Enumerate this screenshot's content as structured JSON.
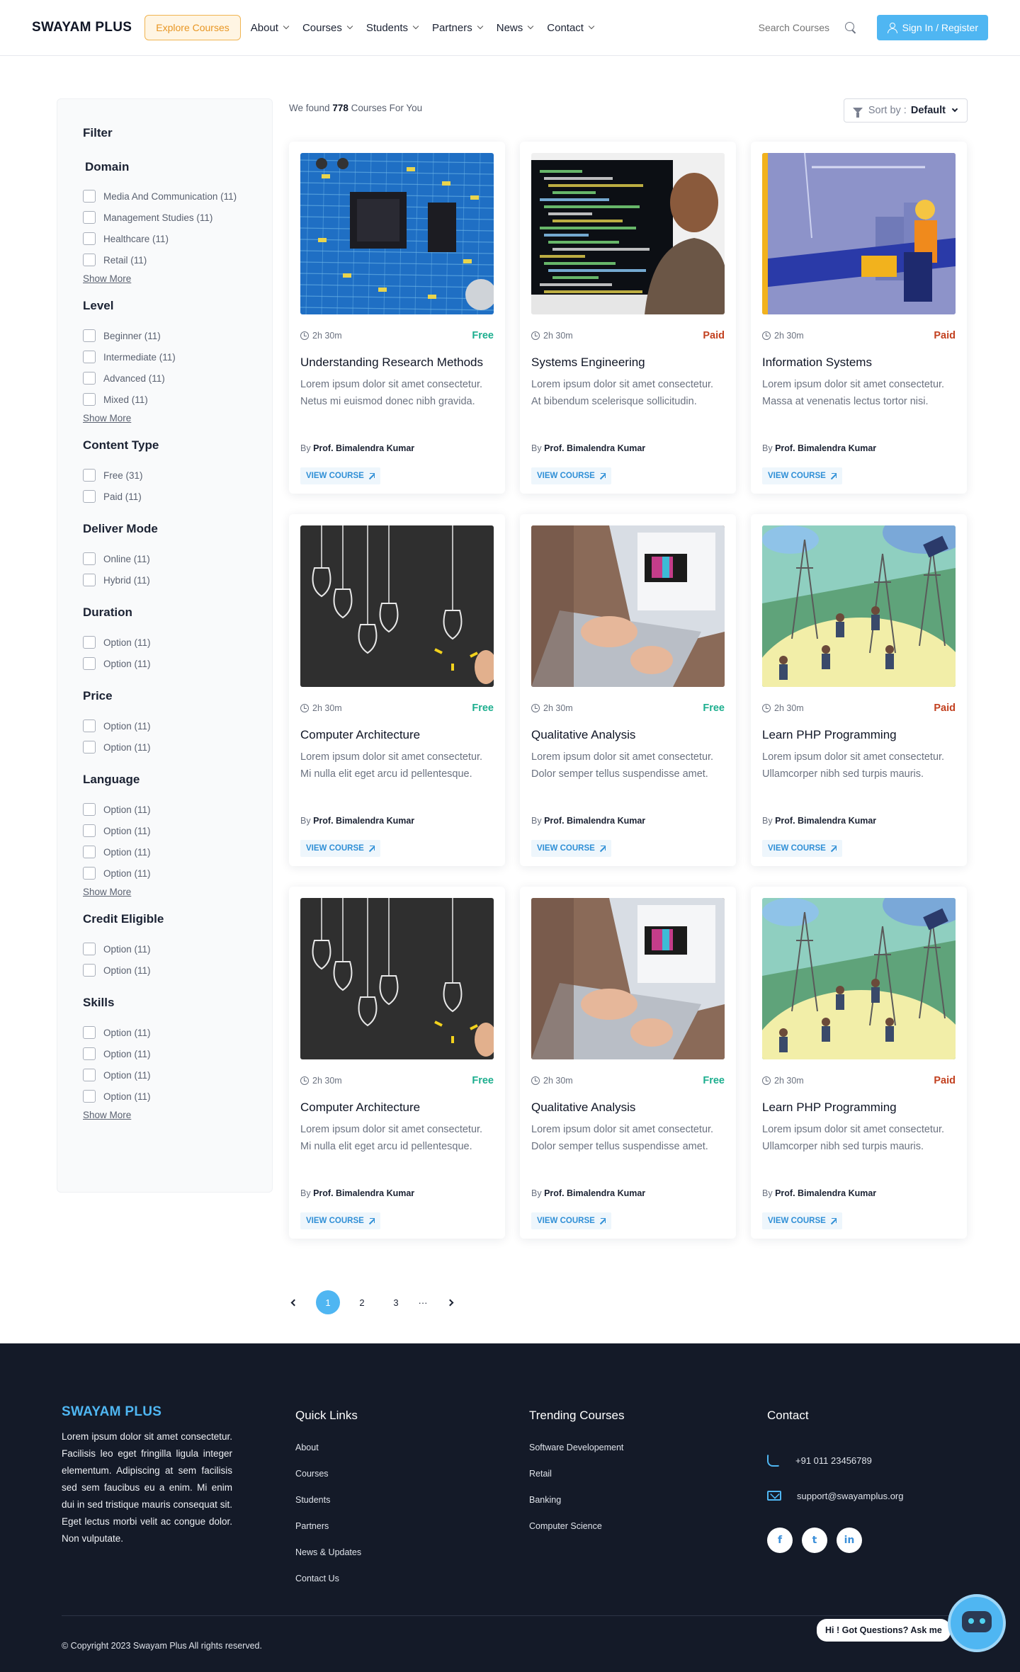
{
  "header": {
    "logo": "SWAYAM PLUS",
    "explore_label": "Explore Courses",
    "nav": [
      "About",
      "Courses",
      "Students",
      "Partners",
      "News",
      "Contact"
    ],
    "search_placeholder": "Search Courses",
    "signin_label": "Sign In / Register"
  },
  "filters": {
    "title": "Filter",
    "show_more": "Show More",
    "groups": [
      {
        "title": "Domain",
        "options": [
          "Media And Communication (11)",
          "Management Studies (11)",
          "Healthcare (11)",
          "Retail (11)"
        ],
        "show_more": true
      },
      {
        "title": "Level",
        "options": [
          "Beginner (11)",
          "Intermediate (11)",
          "Advanced (11)",
          "Mixed (11)"
        ],
        "show_more": true
      },
      {
        "title": "Content Type",
        "options": [
          "Free (31)",
          "Paid (11)"
        ],
        "show_more": false
      },
      {
        "title": "Deliver Mode",
        "options": [
          "Online (11)",
          "Hybrid (11)"
        ],
        "show_more": false
      },
      {
        "title": "Duration",
        "options": [
          "Option (11)",
          "Option (11)"
        ],
        "show_more": false
      },
      {
        "title": "Price",
        "options": [
          "Option (11)",
          "Option (11)"
        ],
        "show_more": false
      },
      {
        "title": "Language",
        "options": [
          "Option (11)",
          "Option (11)",
          "Option (11)",
          "Option (11)"
        ],
        "show_more": true
      },
      {
        "title": "Credit Eligible",
        "options": [
          "Option (11)",
          "Option (11)"
        ],
        "show_more": false
      },
      {
        "title": "Skills",
        "options": [
          "Option (11)",
          "Option (11)",
          "Option (11)",
          "Option (11)"
        ],
        "show_more": true
      }
    ]
  },
  "results": {
    "found_prefix": "We found",
    "found_count": "778",
    "found_suffix": "Courses For You",
    "sort_label": "Sort by :",
    "sort_value": "Default"
  },
  "courses": [
    {
      "image": "circuit",
      "duration": "2h 30m",
      "price": "Free",
      "title": "Understanding Research Methods",
      "desc": "Lorem ipsum dolor sit amet consectetur. Netus mi euismod donec nibh gravida.",
      "by": "By",
      "author": "Prof. Bimalendra Kumar",
      "cta": "VIEW COURSE"
    },
    {
      "image": "code",
      "duration": "2h 30m",
      "price": "Paid",
      "title": "Systems Engineering",
      "desc": "Lorem ipsum dolor sit amet consectetur. At bibendum scelerisque sollicitudin.",
      "by": "By",
      "author": "Prof. Bimalendra Kumar",
      "cta": "VIEW COURSE"
    },
    {
      "image": "construction",
      "duration": "2h 30m",
      "price": "Paid",
      "title": "Information Systems",
      "desc": "Lorem ipsum dolor sit amet consectetur. Massa at venenatis lectus tortor nisi.",
      "by": "By",
      "author": "Prof. Bimalendra Kumar",
      "cta": "VIEW COURSE"
    },
    {
      "image": "bulbs",
      "duration": "2h 30m",
      "price": "Free",
      "title": "Computer Architecture",
      "desc": "Lorem ipsum dolor sit amet consectetur. Mi nulla elit eget arcu id pellentesque.",
      "by": "By",
      "author": "Prof. Bimalendra Kumar",
      "cta": "VIEW COURSE"
    },
    {
      "image": "laptop",
      "duration": "2h 30m",
      "price": "Free",
      "title": "Qualitative Analysis",
      "desc": "Lorem ipsum dolor sit amet consectetur. Dolor semper tellus suspendisse amet.",
      "by": "By",
      "author": "Prof. Bimalendra Kumar",
      "cta": "VIEW COURSE"
    },
    {
      "image": "energy",
      "duration": "2h 30m",
      "price": "Paid",
      "title": "Learn PHP Programming",
      "desc": "Lorem ipsum dolor sit amet consectetur. Ullamcorper nibh sed turpis mauris.",
      "by": "By",
      "author": "Prof. Bimalendra Kumar",
      "cta": "VIEW COURSE"
    },
    {
      "image": "bulbs",
      "duration": "2h 30m",
      "price": "Free",
      "title": "Computer Architecture",
      "desc": "Lorem ipsum dolor sit amet consectetur. Mi nulla elit eget arcu id pellentesque.",
      "by": "By",
      "author": "Prof. Bimalendra Kumar",
      "cta": "VIEW COURSE"
    },
    {
      "image": "laptop",
      "duration": "2h 30m",
      "price": "Free",
      "title": "Qualitative Analysis",
      "desc": "Lorem ipsum dolor sit amet consectetur. Dolor semper tellus suspendisse amet.",
      "by": "By",
      "author": "Prof. Bimalendra Kumar",
      "cta": "VIEW COURSE"
    },
    {
      "image": "energy",
      "duration": "2h 30m",
      "price": "Paid",
      "title": "Learn PHP Programming",
      "desc": "Lorem ipsum dolor sit amet consectetur. Ullamcorper nibh sed turpis mauris.",
      "by": "By",
      "author": "Prof. Bimalendra Kumar",
      "cta": "VIEW COURSE"
    }
  ],
  "pagination": {
    "pages": [
      "1",
      "2",
      "3"
    ],
    "ellipsis": "···",
    "current": "1"
  },
  "footer": {
    "brand": "SWAYAM PLUS",
    "about": "Lorem ipsum dolor sit amet consectetur. Facilisis leo eget fringilla ligula integer elementum. Adipiscing at sem facilisis sed sem faucibus eu a enim. Mi enim dui in sed tristique mauris consequat sit. Eget lectus morbi velit ac congue dolor. Non vulputate.",
    "quick_links_title": "Quick Links",
    "quick_links": [
      "About",
      "Courses",
      "Students",
      "Partners",
      "News & Updates",
      "Contact Us"
    ],
    "trending_title": "Trending Courses",
    "trending": [
      "Software Developement",
      "Retail",
      "Banking",
      "Computer Science"
    ],
    "contact_title": "Contact",
    "phone": "+91 011 23456789",
    "email": "support@swayamplus.org",
    "socials": [
      "f",
      "t",
      "in"
    ],
    "copyright": "© Copyright 2023 Swayam Plus All rights reserved.",
    "chat_label": "Hi ! Got Questions? Ask me"
  },
  "colors": {
    "accent": "#4fb6f2",
    "free": "#1cae8e",
    "paid": "#c2401f",
    "footer_bg": "#141a28"
  }
}
